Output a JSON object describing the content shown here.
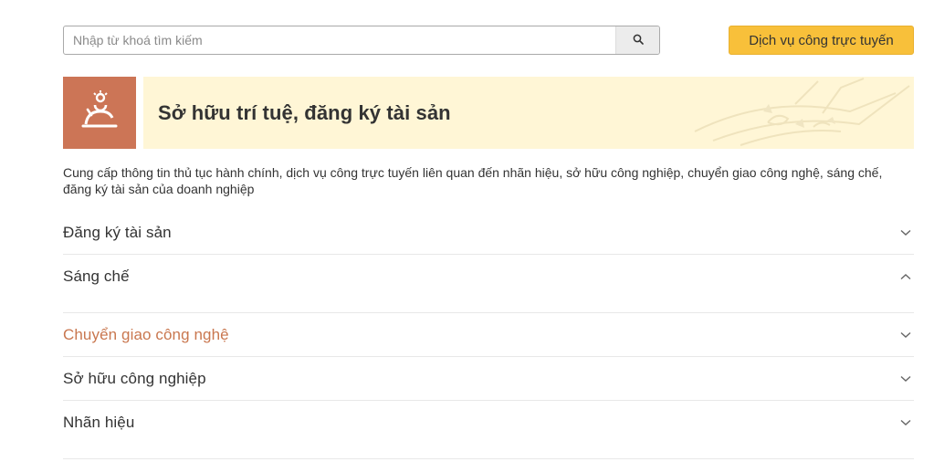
{
  "search": {
    "placeholder": "Nhập từ khoá tìm kiếm",
    "value": ""
  },
  "header": {
    "online_service_label": "Dịch vụ công trực tuyến"
  },
  "hero": {
    "title": "Sở hữu trí tuệ, đăng ký tài sản",
    "icon": "person-award-icon",
    "icon_bg": "#cc7556",
    "banner_bg": "#fff6d6"
  },
  "description": "Cung cấp thông tin thủ tục hành chính, dịch vụ công trực tuyến liên quan đến nhãn hiệu, sở hữu công nghiệp, chuyển giao công nghệ, sáng chế, đăng ký tài sản của doanh nghiệp",
  "accordion": {
    "items": [
      {
        "label": "Đăng ký tài sản",
        "state": "collapsed"
      },
      {
        "label": "Sáng chế",
        "state": "expanded"
      },
      {
        "label": "Chuyển giao công nghệ",
        "state": "collapsed-hover"
      },
      {
        "label": "Sở hữu công nghiệp",
        "state": "collapsed"
      },
      {
        "label": "Nhãn hiệu",
        "state": "collapsed"
      }
    ]
  },
  "colors": {
    "accent": "#f8c03a",
    "active_text": "#c9774f"
  }
}
